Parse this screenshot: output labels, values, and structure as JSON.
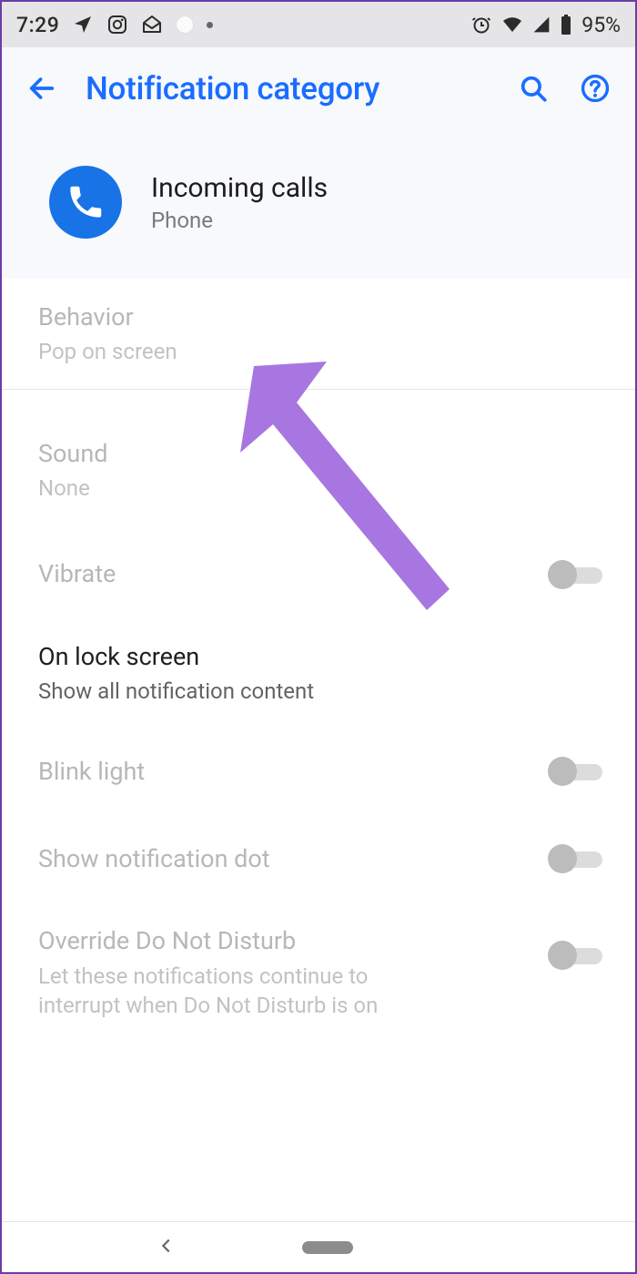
{
  "status": {
    "time": "7:29",
    "battery": "95%"
  },
  "appbar": {
    "title": "Notification category"
  },
  "channel": {
    "title": "Incoming calls",
    "app": "Phone"
  },
  "settings": {
    "behavior": {
      "label": "Behavior",
      "value": "Pop on screen"
    },
    "sound": {
      "label": "Sound",
      "value": "None"
    },
    "vibrate": {
      "label": "Vibrate"
    },
    "lockscreen": {
      "label": "On lock screen",
      "value": "Show all notification content"
    },
    "blink": {
      "label": "Blink light"
    },
    "dot": {
      "label": "Show notification dot"
    },
    "override": {
      "label": "Override Do Not Disturb",
      "value": "Let these notifications continue to interrupt when Do Not Disturb is on"
    }
  },
  "colors": {
    "accent": "#1a6dff",
    "arrow": "#a876e0"
  }
}
